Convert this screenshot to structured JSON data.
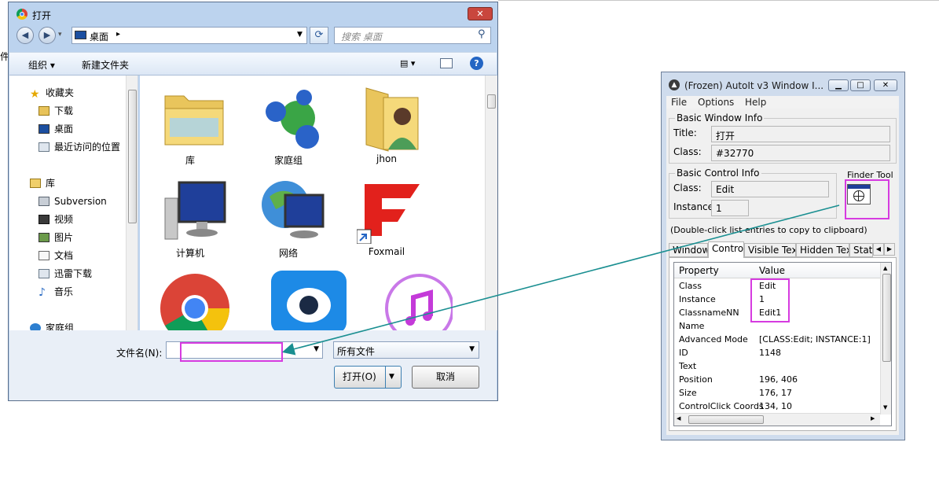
{
  "open_dialog": {
    "title": "打开",
    "address": {
      "location": "桌面",
      "separator": "▸"
    },
    "search": {
      "placeholder": "搜索 桌面"
    },
    "toolbar": {
      "organize": "组织 ▾",
      "new_folder": "新建文件夹",
      "view": "▤ ▾"
    },
    "nav": {
      "favorites": "收藏夹",
      "items_favorites": [
        "下载",
        "桌面",
        "最近访问的位置"
      ],
      "libraries": "库",
      "items_libraries": [
        "Subversion",
        "视频",
        "图片",
        "文档",
        "迅雷下载",
        "音乐"
      ],
      "homegroup": "家庭组"
    },
    "tiles": [
      "库",
      "家庭组",
      "jhon",
      "计算机",
      "网络",
      "Foxmail",
      "",
      "",
      ""
    ],
    "filename_label": "文件名(N):",
    "filename_value": "",
    "filetype": "所有文件",
    "open_button": "打开(O)",
    "cancel_button": "取消"
  },
  "side_fragment": "件",
  "autoit": {
    "title": "(Frozen) AutoIt v3 Window I...",
    "menu": [
      "File",
      "Options",
      "Help"
    ],
    "basic_window_info": "Basic Window Info",
    "title_label": "Title:",
    "title_value": "打开",
    "class_label": "Class:",
    "class_value": "#32770",
    "basic_control_info": "Basic Control Info",
    "finder_tool": "Finder Tool",
    "ctrl_class_label": "Class:",
    "ctrl_class_value": "Edit",
    "instance_label": "Instance:",
    "instance_value": "1",
    "hint": "(Double-click list entries to copy to clipboard)",
    "tabs": [
      "Window",
      "Control",
      "Visible Text",
      "Hidden Text",
      "Stat"
    ],
    "columns": [
      "Property",
      "Value"
    ],
    "rows": [
      {
        "property": "Class",
        "value": "Edit"
      },
      {
        "property": "Instance",
        "value": "1"
      },
      {
        "property": "ClassnameNN",
        "value": "Edit1"
      },
      {
        "property": "Name",
        "value": ""
      },
      {
        "property": "Advanced Mode",
        "value": "[CLASS:Edit; INSTANCE:1]"
      },
      {
        "property": "ID",
        "value": "1148"
      },
      {
        "property": "Text",
        "value": ""
      },
      {
        "property": "Position",
        "value": "196, 406"
      },
      {
        "property": "Size",
        "value": "176, 17"
      },
      {
        "property": "ControlClick Coords",
        "value": "134, 10"
      }
    ]
  },
  "colors": {
    "highlight": "#d63be0",
    "arrow": "#1a8f91"
  }
}
